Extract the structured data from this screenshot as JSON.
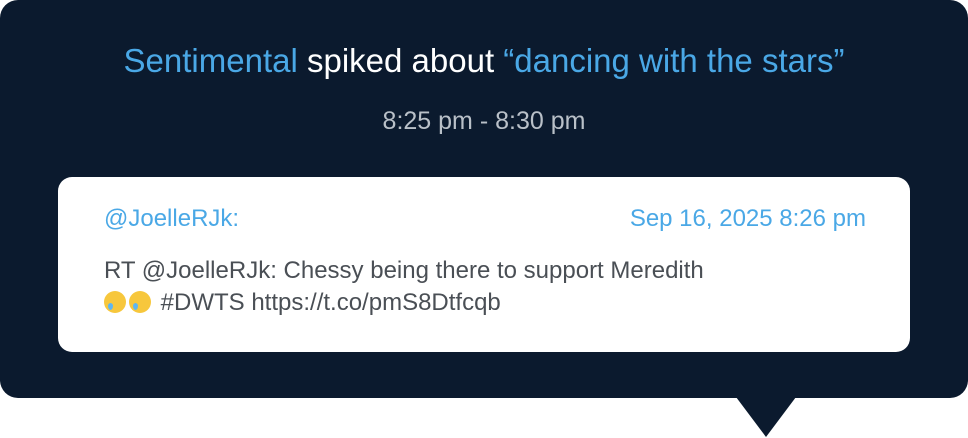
{
  "tooltip": {
    "headline": {
      "sentiment": "Sentimental",
      "verb": " spiked about ",
      "topic": "“dancing with the stars”"
    },
    "time_range": "8:25 pm - 8:30 pm",
    "post": {
      "handle": "@JoelleRJk:",
      "timestamp": "Sep 16, 2025 8:26 pm",
      "text_line1": "RT @JoelleRJk: Chessy being there to support Meredith",
      "emoji_icon": "crying-face-icon",
      "text_line2": " #DWTS https://t.co/pmS8Dtfcqb"
    }
  },
  "colors": {
    "background": "#0b1a2e",
    "accent": "#4aa8e6",
    "card": "#ffffff"
  }
}
